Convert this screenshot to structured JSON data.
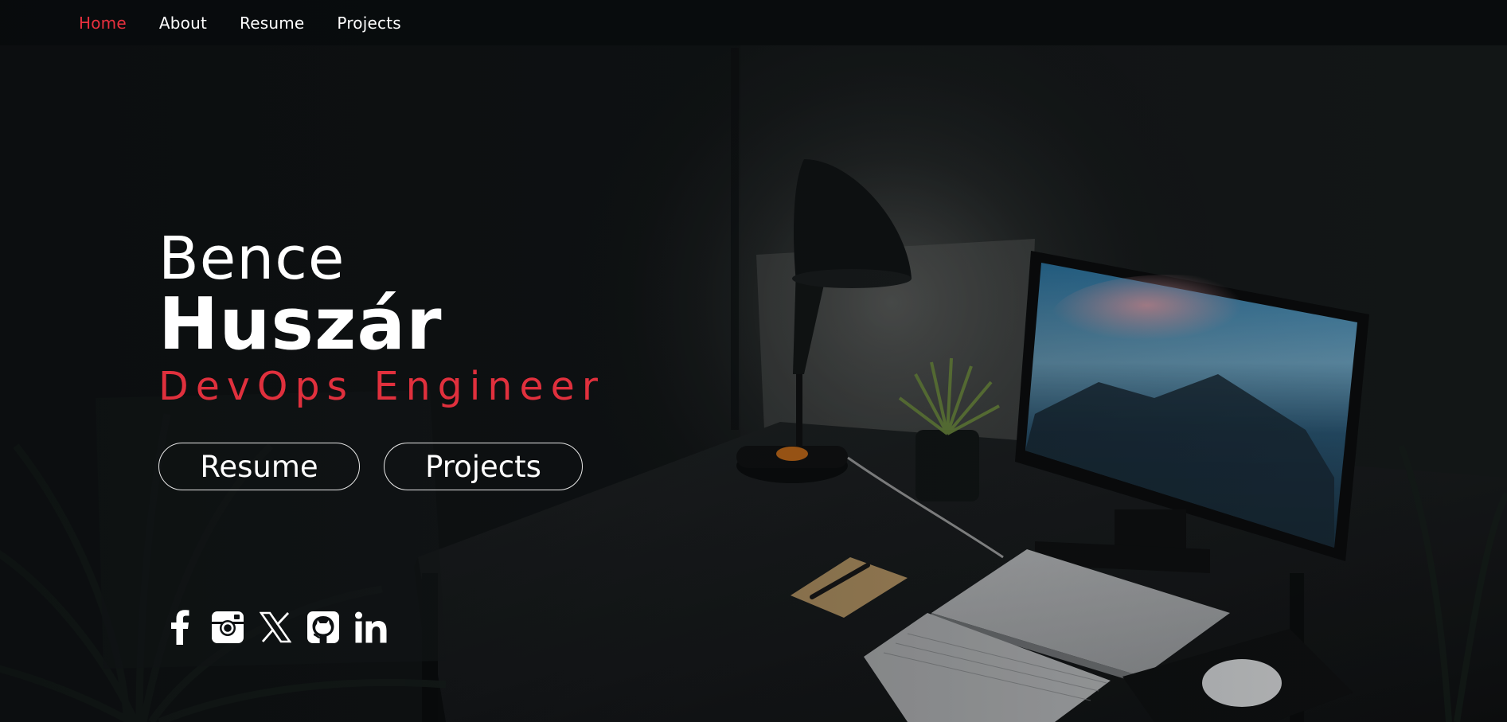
{
  "nav": {
    "items": [
      {
        "label": "Home",
        "active": true
      },
      {
        "label": "About",
        "active": false
      },
      {
        "label": "Resume",
        "active": false
      },
      {
        "label": "Projects",
        "active": false
      }
    ]
  },
  "hero": {
    "first_name": "Bence",
    "last_name": "Huszár",
    "role": "DevOps Engineer"
  },
  "buttons": {
    "resume": "Resume",
    "projects": "Projects"
  },
  "socials": [
    {
      "icon": "facebook-icon"
    },
    {
      "icon": "instagram-icon"
    },
    {
      "icon": "x-twitter-icon"
    },
    {
      "icon": "github-icon"
    },
    {
      "icon": "linkedin-icon"
    }
  ],
  "colors": {
    "accent": "#e0303d",
    "text": "#ffffff",
    "nav_bg": "#0a0d0f"
  }
}
